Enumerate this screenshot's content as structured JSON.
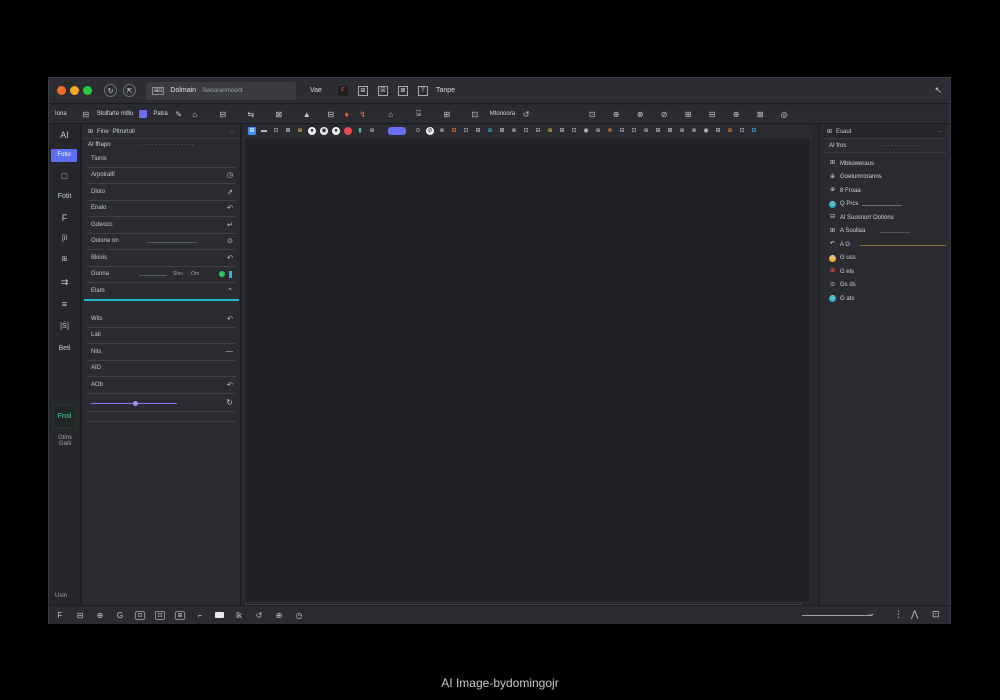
{
  "titlebar": {
    "window_dots": [
      "#f26a2a",
      "#f5a623",
      "#27c93f"
    ],
    "icon1": "↻",
    "icon2": "⇱",
    "tab_icon": "⊞⊟",
    "tab_title": "Dolmain",
    "tab_subtitle": "Swooranmoorlt",
    "file_label": "Vae",
    "brand_icon": "F",
    "icons": [
      "⊞",
      "☒",
      "⊠",
      "⊤"
    ],
    "menu_label": "Tanpe"
  },
  "toolbar": {
    "mode_label": "Iona",
    "workspace_label": "Stolfarte mtllu",
    "pages_label": "Patra",
    "right_label": "Mtonoora",
    "icons_left": [
      "✎",
      "⌂",
      "⊟",
      "⇆",
      "⊠",
      "▲",
      "⊟",
      "⊞",
      "♦",
      "↯"
    ],
    "icons_mid": [
      "⌂",
      "⌸",
      "⊞",
      "⊡",
      "⊟",
      "⊠"
    ],
    "icons_right": [
      "⊡",
      "⊕",
      "⊗",
      "⊘",
      "⊞",
      "⊟",
      "⊕",
      "⊠",
      "◎",
      "⊡",
      "⊕"
    ]
  },
  "rail": {
    "items": [
      {
        "label": "AI",
        "active": false
      },
      {
        "label": "Fotio",
        "active": true
      },
      {
        "label": "□",
        "active": false
      },
      {
        "label": "Fotit",
        "active": false
      },
      {
        "label": "F",
        "active": false
      },
      {
        "label": "[il",
        "active": false
      },
      {
        "label": "⊞",
        "active": false
      },
      {
        "label": "⇉",
        "active": false
      },
      {
        "label": "≡",
        "active": false
      },
      {
        "label": "[Ŝ]",
        "active": false
      },
      {
        "label": "Betl",
        "active": false
      }
    ],
    "preview_label": "Froil",
    "preview_sub": "Gtins Gatli",
    "bottom_label": "Usin"
  },
  "layers": {
    "head_tabs": [
      "Fine",
      "Pltrurtoll"
    ],
    "sub_title": "AI ffrapo",
    "rows": [
      {
        "label": "Tiunis",
        "icon": ""
      },
      {
        "label": "Arpoiralfl",
        "icon": "◷"
      },
      {
        "label": "Dloto",
        "icon": "⇗"
      },
      {
        "label": "Enalo",
        "icon": "↶"
      },
      {
        "label": "Gdwocc",
        "icon": "↵"
      },
      {
        "label": "Oolone on",
        "icon": "⊙"
      },
      {
        "label": "Bkiois",
        "icon": "↶"
      },
      {
        "label": "Gunna",
        "icon": "",
        "mid1": "Sloo",
        "mid2": "Oro"
      },
      {
        "label": "Elam",
        "icon": "⌃"
      }
    ],
    "rows2": [
      {
        "label": "Wits",
        "icon": "↶"
      },
      {
        "label": "Lati",
        "icon": ""
      },
      {
        "label": "Nits",
        "icon": "—"
      },
      {
        "label": "AID",
        "icon": ""
      },
      {
        "label": "AOb",
        "icon": "↶"
      }
    ]
  },
  "canvas_toolbar": {
    "icons": [
      "⊞",
      "▬",
      "⊡",
      "⊠",
      "⊕",
      "●",
      "◉",
      "●",
      "▮",
      "⊕",
      "⊙",
      "⊘",
      "⊗",
      "⊟",
      "⊡",
      "⊞",
      "⊕",
      "⊠",
      "⊗",
      "⊡",
      "⊟",
      "⊕",
      "⊞",
      "⊡",
      "◉",
      "⊕",
      "⊗",
      "⊟",
      "⊡",
      "⊕",
      "⊞",
      "⊠",
      "⊕",
      "⊗",
      "◉",
      "⊞",
      "⊕",
      "⊡",
      "⊟",
      "⊕",
      "◉",
      "⊙"
    ]
  },
  "props": {
    "head_label": "Esaut",
    "sub_title": "AI fros",
    "rows": [
      {
        "icon": "⊞",
        "label": "Mbkoweraus",
        "style": ""
      },
      {
        "icon": "⊕",
        "label": "Goetumroranns",
        "style": ""
      },
      {
        "icon": "⊕",
        "label": "8 Froaa",
        "style": ""
      },
      {
        "icon": "⊙",
        "label": "Q Prcs",
        "style": "teal"
      },
      {
        "icon": "⊟",
        "label": "Al Suosnurr Ootions",
        "style": ""
      },
      {
        "icon": "⊞",
        "label": "A Soullaa",
        "style": ""
      },
      {
        "icon": "↶",
        "label": "A G",
        "style": ""
      },
      {
        "icon": "⊕",
        "label": "G uss",
        "style": "yellow"
      },
      {
        "icon": "⊞",
        "label": "G els",
        "style": ""
      },
      {
        "icon": "⊙",
        "label": "Gs ds",
        "style": ""
      },
      {
        "icon": "⊙",
        "label": "G ats",
        "style": "teal"
      }
    ]
  },
  "statusbar": {
    "icons": [
      "F",
      "⊟",
      "⊕",
      "G",
      "⊡",
      "⊡",
      "⊞",
      "⌐",
      "▬",
      "lk",
      "↺",
      "⊕",
      "◷"
    ],
    "right_icons": [
      "⋮",
      "⋀",
      "⊡"
    ]
  },
  "caption": "AI Image-bydomingojr"
}
